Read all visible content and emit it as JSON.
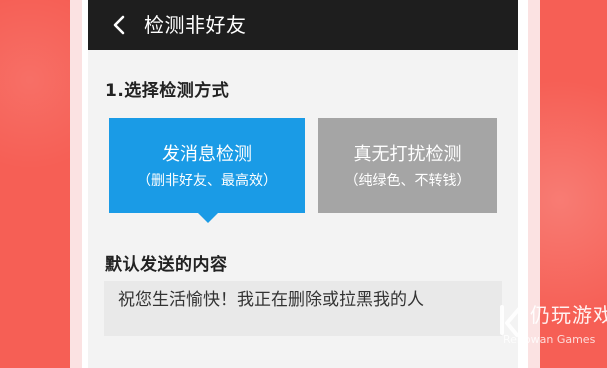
{
  "header": {
    "title": "检测非好友",
    "back_icon": "chevron-left-icon"
  },
  "section_1": {
    "title": "1.选择检测方式"
  },
  "options": [
    {
      "main": "发消息检测",
      "sub": "（删非好友、最高效）",
      "selected": true,
      "color": "#1a9be6"
    },
    {
      "main": "真无打扰检测",
      "sub": "（纯绿色、不转钱）",
      "selected": false,
      "color": "#a5a5a5"
    }
  ],
  "section_2": {
    "title": "默认发送的内容"
  },
  "message": {
    "text": "祝您生活愉快！我正在删除或拉黑我的人"
  },
  "watermark": {
    "title": "仍玩游戏",
    "subtitle": "Renowan Games"
  },
  "colors": {
    "background": "#f65f55",
    "header": "#1e1e1e",
    "accent": "#1a9be6"
  }
}
